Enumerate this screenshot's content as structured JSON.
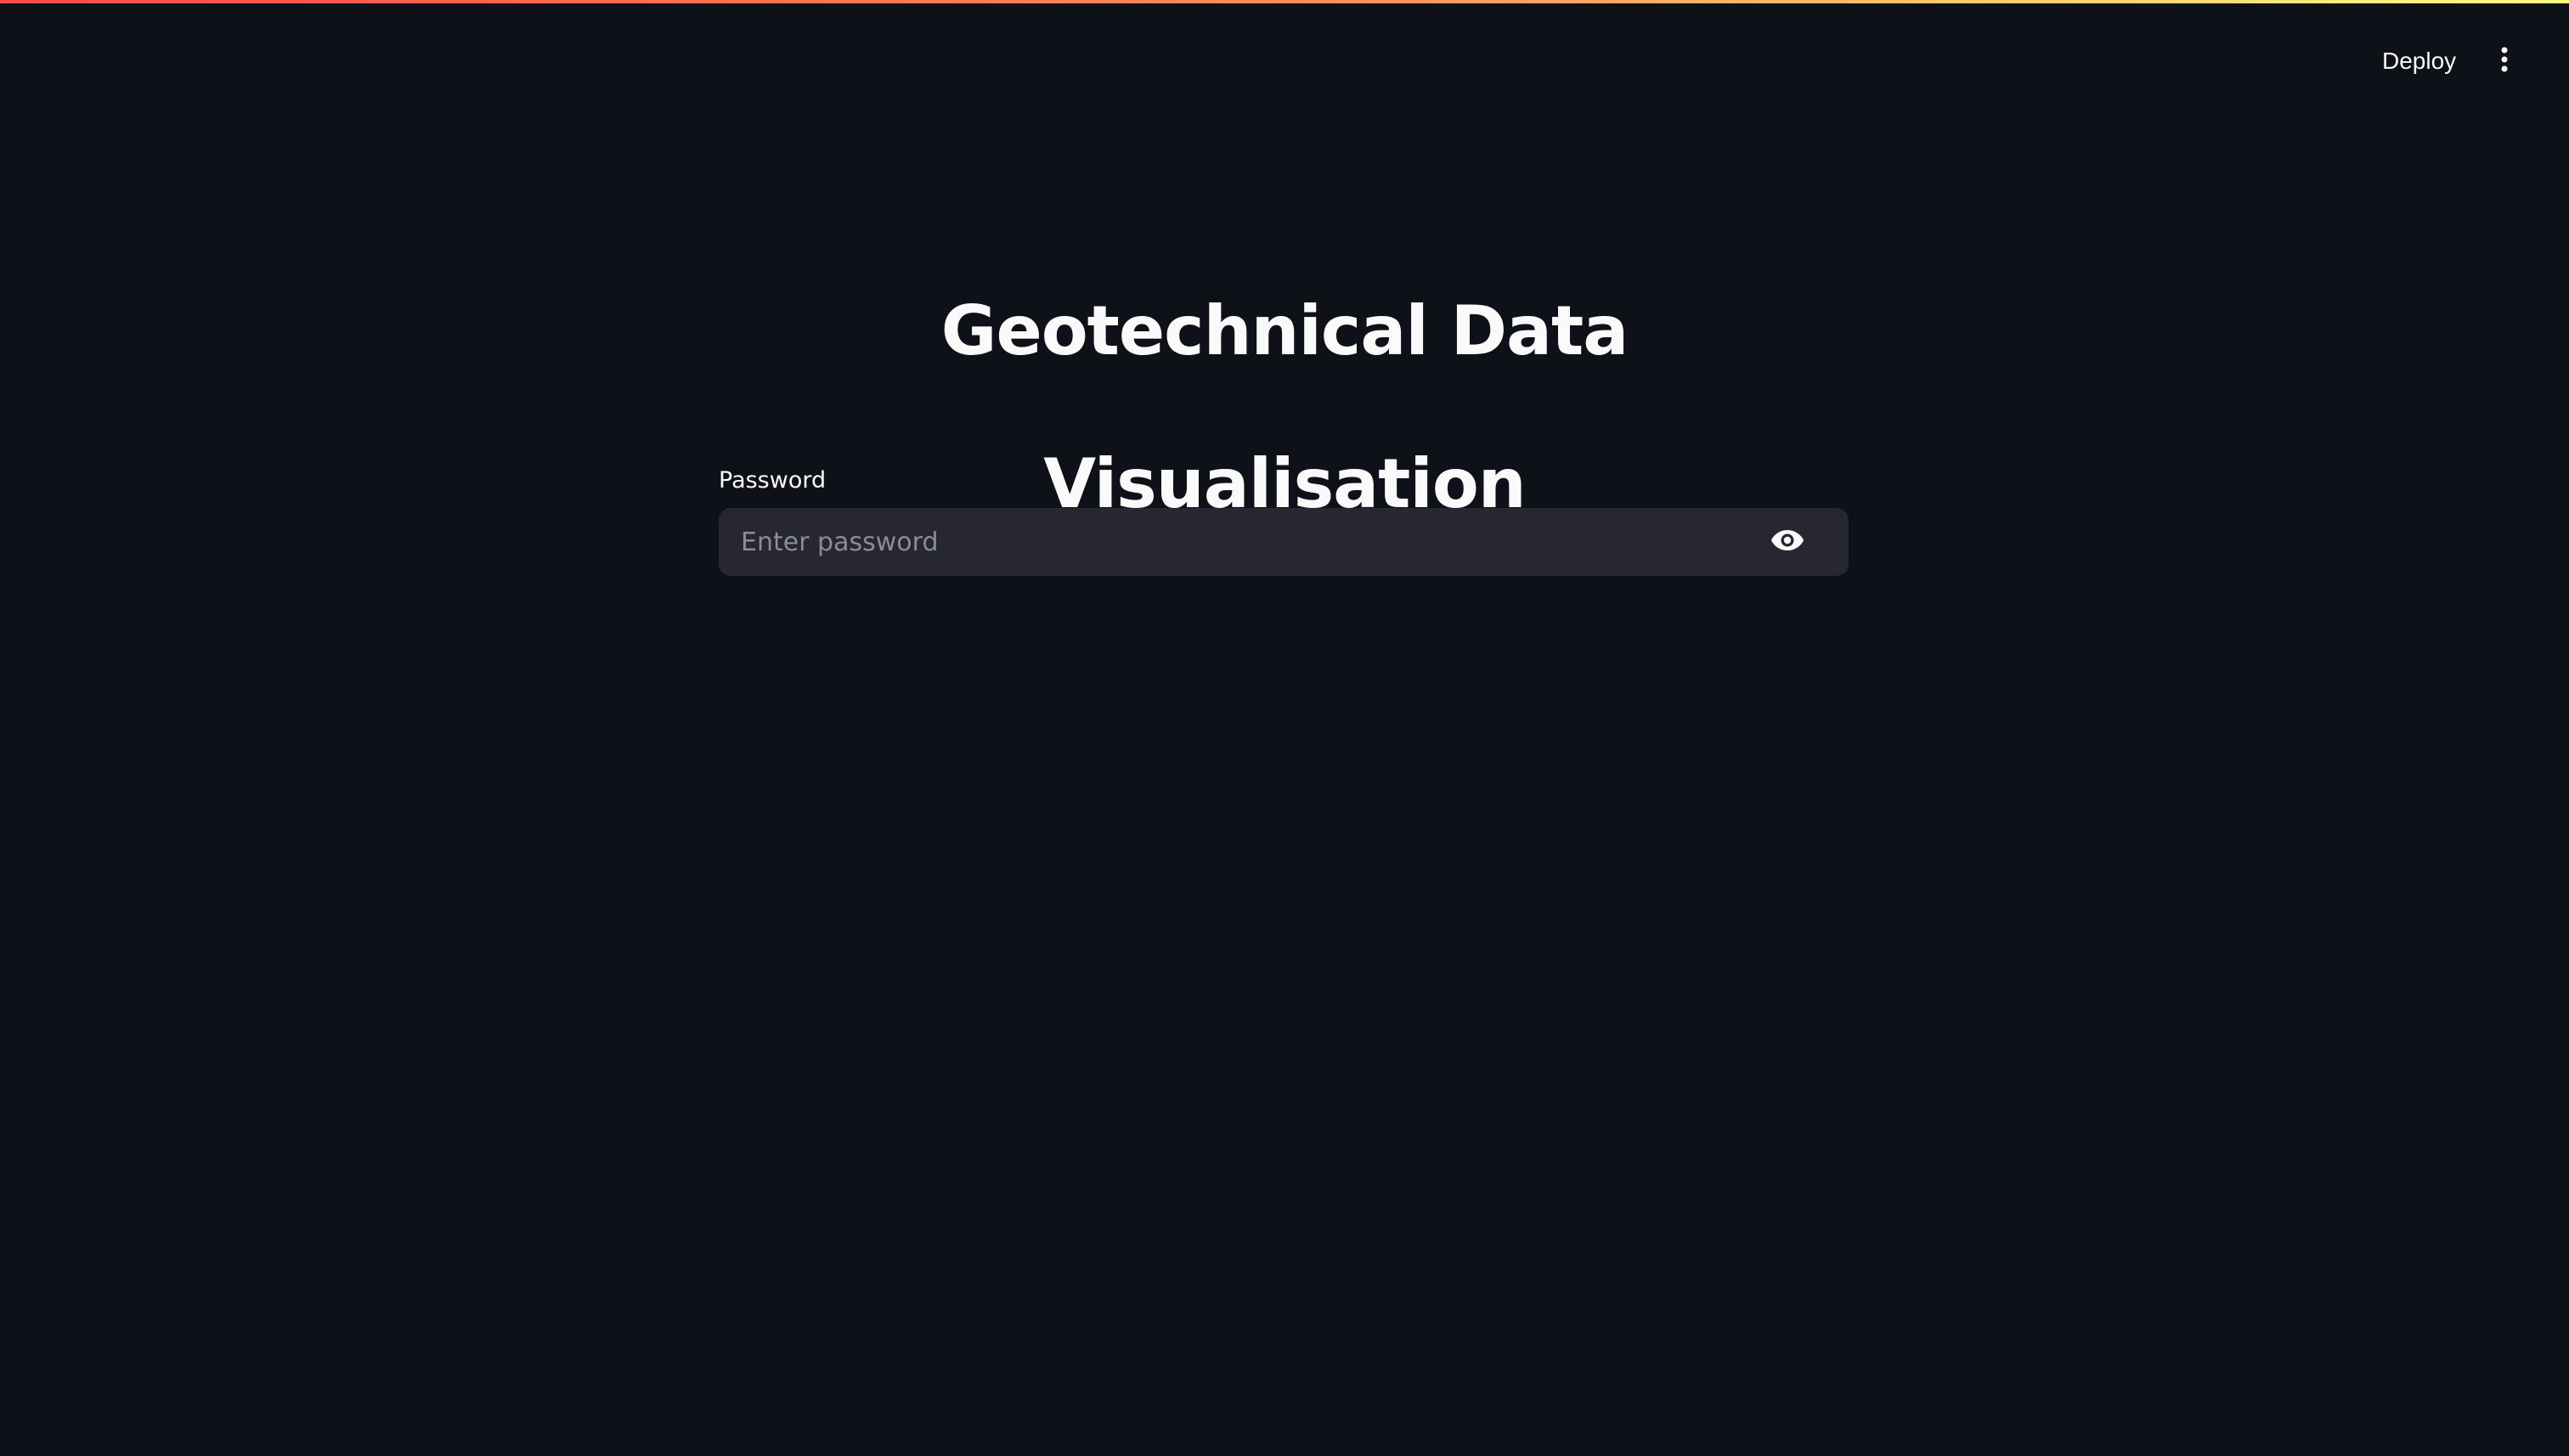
{
  "header": {
    "deploy_label": "Deploy",
    "menu_icon": "more-vertical-icon"
  },
  "main": {
    "title": "Geotechnical Data Visualisation",
    "password_field": {
      "label": "Password",
      "value": "",
      "placeholder": "Enter password",
      "toggle_icon": "eye-icon"
    }
  },
  "colors": {
    "background": "#0e1117",
    "input_background": "#262730",
    "text": "#fafafa",
    "placeholder": "#8a8d96",
    "accent_gradient_start": "#ff4b4b",
    "accent_gradient_end": "#fffd80"
  }
}
